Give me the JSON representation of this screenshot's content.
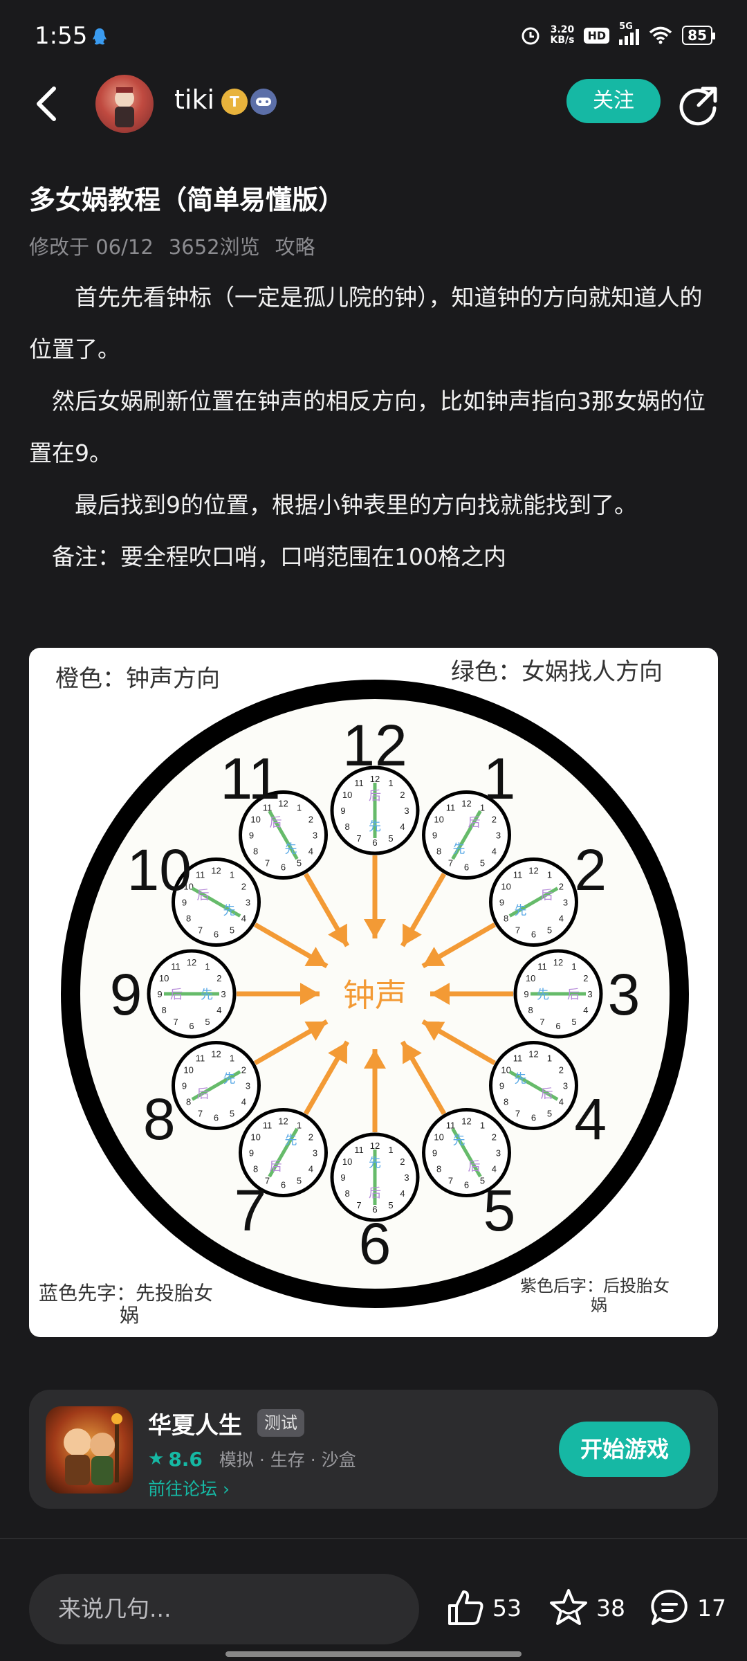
{
  "status": {
    "time": "1:55",
    "net_speed_top": "3.20",
    "net_speed_bottom": "KB/s",
    "hd": "HD",
    "network": "5G",
    "battery": "85"
  },
  "header": {
    "username": "tiki",
    "badge_t": "T",
    "follow_label": "关注"
  },
  "article": {
    "title": "多女娲教程（简单易懂版）",
    "meta_date": "修改于 06/12",
    "meta_views": "3652浏览",
    "meta_category": "攻略",
    "paragraphs": [
      "　　首先先看钟标（一定是孤儿院的钟），知道钟的方向就知道人的位置了。",
      "　然后女娲刷新位置在钟声的相反方向，比如钟声指向3那女娲的位置在9。",
      "　　最后找到9的位置，根据小钟表里的方向找就能找到了。",
      "　备注：要全程吹口哨，口哨范围在100格之内"
    ]
  },
  "image": {
    "legend_orange": "橙色：钟声方向",
    "legend_green": "绿色：女娲找人方向",
    "legend_blue_line1": "蓝色先字：先投胎女",
    "legend_blue_line2": "娲",
    "legend_purple_line1": "紫色后字：后投胎女",
    "legend_purple_line2": "娲",
    "center_label": "钟声",
    "first_char": "先",
    "later_char": "后",
    "numbers": [
      "12",
      "1",
      "2",
      "3",
      "4",
      "5",
      "6",
      "7",
      "8",
      "9",
      "10",
      "11"
    ],
    "colors": {
      "orange": "#f39a35",
      "green": "#66bb6a",
      "blue": "#5aa9e6",
      "purple": "#b58ad8"
    }
  },
  "game_card": {
    "name": "华夏人生",
    "badge": "测试",
    "rating": "8.6",
    "tags": "模拟  ·  生存  ·  沙盒",
    "forum_link": "前往论坛 ›",
    "start_label": "开始游戏"
  },
  "bottom_bar": {
    "comment_placeholder": "来说几句...",
    "likes": "53",
    "favorites": "38",
    "comments": "17"
  },
  "colors": {
    "accent": "#16b8a4",
    "background": "#1a1a1c",
    "card": "#2c2c2e"
  }
}
